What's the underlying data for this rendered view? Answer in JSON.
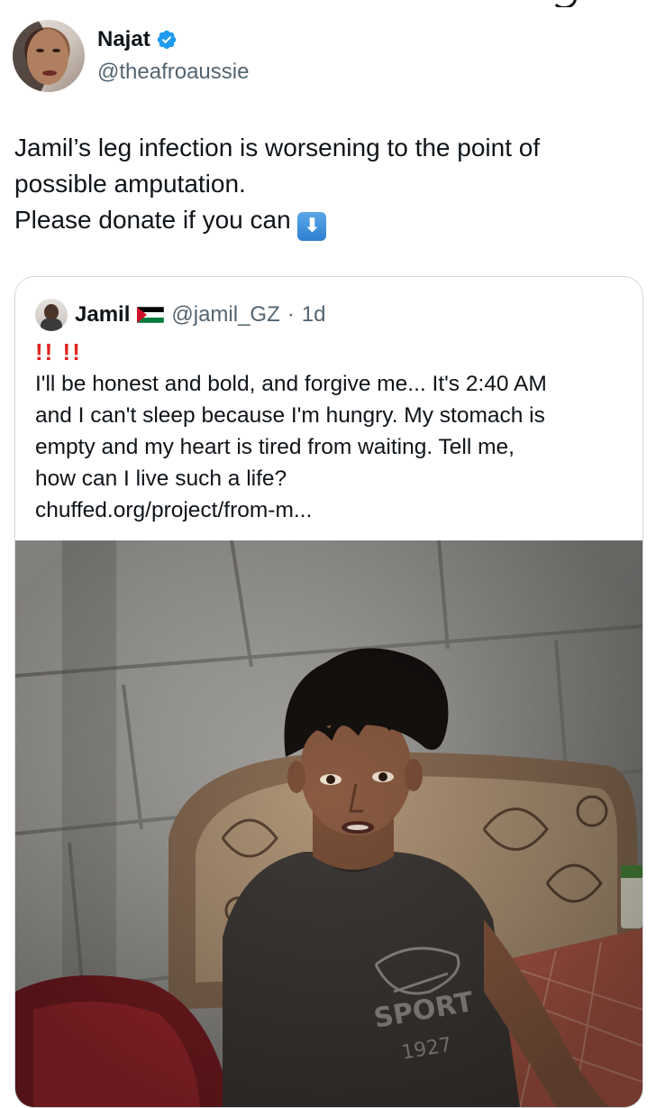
{
  "author": {
    "display_name": "Najat",
    "handle": "@theafroaussie",
    "verified": true,
    "accent_color": "#1d9bf0"
  },
  "tweet": {
    "lines": [
      "Jamil’s leg infection is worsening to the point of",
      "possible amputation.",
      "Please donate if you can"
    ],
    "emoji": "down-arrow-emoji"
  },
  "quoted": {
    "display_name": "Jamil",
    "flag": "palestine-flag",
    "handle": "@jamil_GZ",
    "separator": "·",
    "time": "1d",
    "bangs": "!! !!",
    "lines": [
      "I'll be honest and bold, and forgive me... It's 2:40 AM",
      "and I can't sleep because I'm hungry. My stomach is",
      "empty and my heart is tired from waiting. Tell me,",
      "how can I live such a life?",
      "chuffed.org/project/from-m..."
    ]
  }
}
